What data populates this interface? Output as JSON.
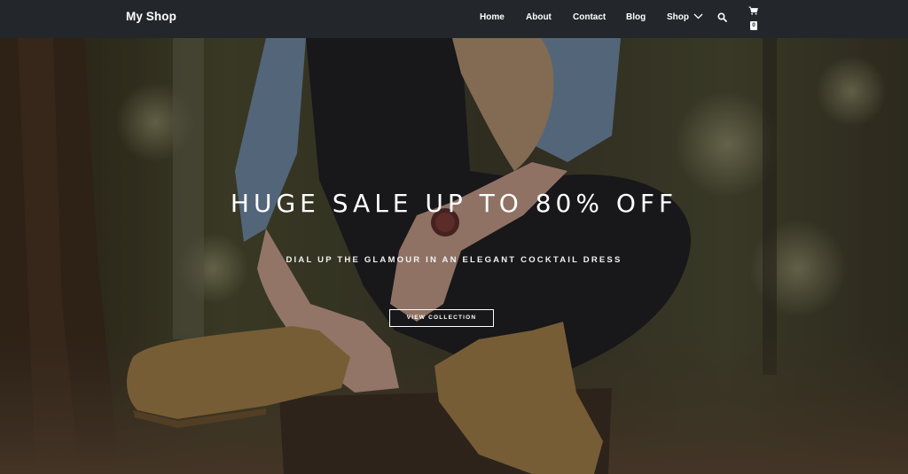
{
  "header": {
    "brand": "My Shop",
    "nav": {
      "home": "Home",
      "about": "About",
      "contact": "Contact",
      "blog": "Blog",
      "shop": "Shop"
    },
    "search_icon": "search-icon",
    "cart": {
      "icon": "cart-icon",
      "count": "0"
    }
  },
  "hero": {
    "title": "HUGE SALE UP TO 80% OFF",
    "subtitle": "DIAL UP THE GLAMOUR IN AN ELEGANT COCKTAIL DRESS",
    "button_label": "VIEW COLLECTION",
    "background_image": "woman-sitting-on-tree-stump-tying-boots-in-forest"
  },
  "colors": {
    "navbar_bg": "#23272b",
    "text": "#ffffff"
  }
}
